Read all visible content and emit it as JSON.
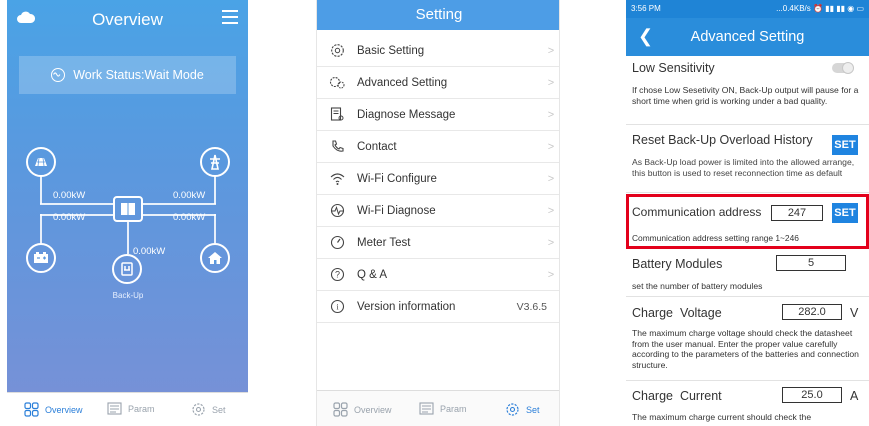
{
  "overview": {
    "title": "Overview",
    "status": "Work Status:Wait Mode",
    "values": {
      "grid_left": "0.00kW",
      "grid_right": "0.00kW",
      "pv_left": "0.00kW",
      "pv_right": "0.00kW",
      "backup": "0.00kW"
    },
    "backup_label": "Back-Up",
    "nav": [
      {
        "label": "Overview",
        "icon": "grid-icon"
      },
      {
        "label": "Param",
        "icon": "param-icon"
      },
      {
        "label": "Set",
        "icon": "gear-icon"
      }
    ],
    "accent": "#4aa3e6"
  },
  "setting": {
    "title": "Setting",
    "items": [
      {
        "label": "Basic Setting",
        "icon": "gear-icon"
      },
      {
        "label": "Advanced Setting",
        "icon": "gears-icon"
      },
      {
        "label": "Diagnose Message",
        "icon": "document-search-icon"
      },
      {
        "label": "Contact",
        "icon": "phone-icon"
      },
      {
        "label": "Wi-Fi Configure",
        "icon": "wifi-icon"
      },
      {
        "label": "Wi-Fi Diagnose",
        "icon": "pulse-icon"
      },
      {
        "label": "Meter Test",
        "icon": "meter-icon"
      },
      {
        "label": "Q & A",
        "icon": "question-icon"
      },
      {
        "label": "Version information",
        "icon": "info-icon",
        "value": "V3.6.5"
      }
    ],
    "nav": [
      {
        "label": "Overview"
      },
      {
        "label": "Param"
      },
      {
        "label": "Set"
      }
    ],
    "accent": "#4d9de6"
  },
  "advanced": {
    "status_time": "3:56 PM",
    "status_right": "...0.4KB/s ⏰ ▮▮ ▮▮ ◉ ▭",
    "title": "Advanced Setting",
    "low_sensitivity": {
      "label": "Low Sensitivity",
      "desc": "If chose Low Sesetivity ON, Back-Up output will pause for a short time when grid is working under a bad quality."
    },
    "reset_overload": {
      "label": "Reset Back-Up Overload History",
      "button": "SET",
      "desc": "As Back-Up load power is limited into the allowed arrange, this button is used to reset reconnection time as default"
    },
    "comm_address": {
      "label": "Communication address",
      "value": "247",
      "button": "SET",
      "desc": "Communication address setting range 1~246"
    },
    "battery_modules": {
      "label": "Battery Modules",
      "value": "5",
      "desc": "set the number of battery modules"
    },
    "charge_voltage": {
      "label": "Charge  Voltage",
      "value": "282.0",
      "unit": "V",
      "desc": "The maximum charge voltage should check the datasheet from the user manual. Enter the proper value carefully according to the parameters of the batteries and connection structure."
    },
    "charge_current": {
      "label": "Charge  Current",
      "value": "25.0",
      "unit": "A",
      "desc": "The maximum charge current should check the"
    },
    "accent": "#2a8ddb",
    "highlight": "#e3001b"
  }
}
